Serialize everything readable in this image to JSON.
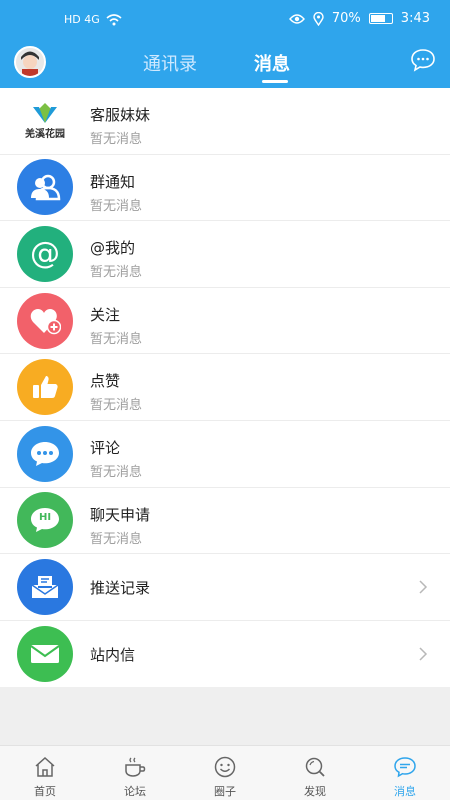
{
  "status": {
    "left_text": "HD 4G",
    "battery": "70%",
    "time": "3:43"
  },
  "header": {
    "tabs": [
      "通讯录",
      "消息"
    ],
    "active_tab": "消息"
  },
  "items": [
    {
      "title": "客服妹妹",
      "sub": "暂无消息",
      "icon": "brand-logo",
      "color": "#ffffff",
      "logo_text": "羌溪花园"
    },
    {
      "title": "群通知",
      "sub": "暂无消息",
      "icon": "group-icon",
      "color": "#2d7fe4"
    },
    {
      "title": "@我的",
      "sub": "暂无消息",
      "icon": "at-icon",
      "color": "#22b07d"
    },
    {
      "title": "关注",
      "sub": "暂无消息",
      "icon": "heart-plus-icon",
      "color": "#f2616a"
    },
    {
      "title": "点赞",
      "sub": "暂无消息",
      "icon": "thumbs-up-icon",
      "color": "#f8ac22"
    },
    {
      "title": "评论",
      "sub": "暂无消息",
      "icon": "comment-icon",
      "color": "#3394e8"
    },
    {
      "title": "聊天申请",
      "sub": "暂无消息",
      "icon": "chat-hi-icon",
      "color": "#42b85a",
      "hi": "HI"
    },
    {
      "title": "推送记录",
      "icon": "push-record-icon",
      "color": "#2a78e0"
    },
    {
      "title": "站内信",
      "icon": "mail-icon",
      "color": "#3dbe52"
    }
  ],
  "nav": [
    {
      "label": "首页",
      "icon": "home-icon"
    },
    {
      "label": "论坛",
      "icon": "coffee-icon"
    },
    {
      "label": "圈子",
      "icon": "smile-circle-icon"
    },
    {
      "label": "发现",
      "icon": "search-icon"
    },
    {
      "label": "消息",
      "icon": "message-icon",
      "active": true
    }
  ],
  "colors": {
    "accent": "#2fa5ec",
    "subtext": "#9e9e9e"
  }
}
